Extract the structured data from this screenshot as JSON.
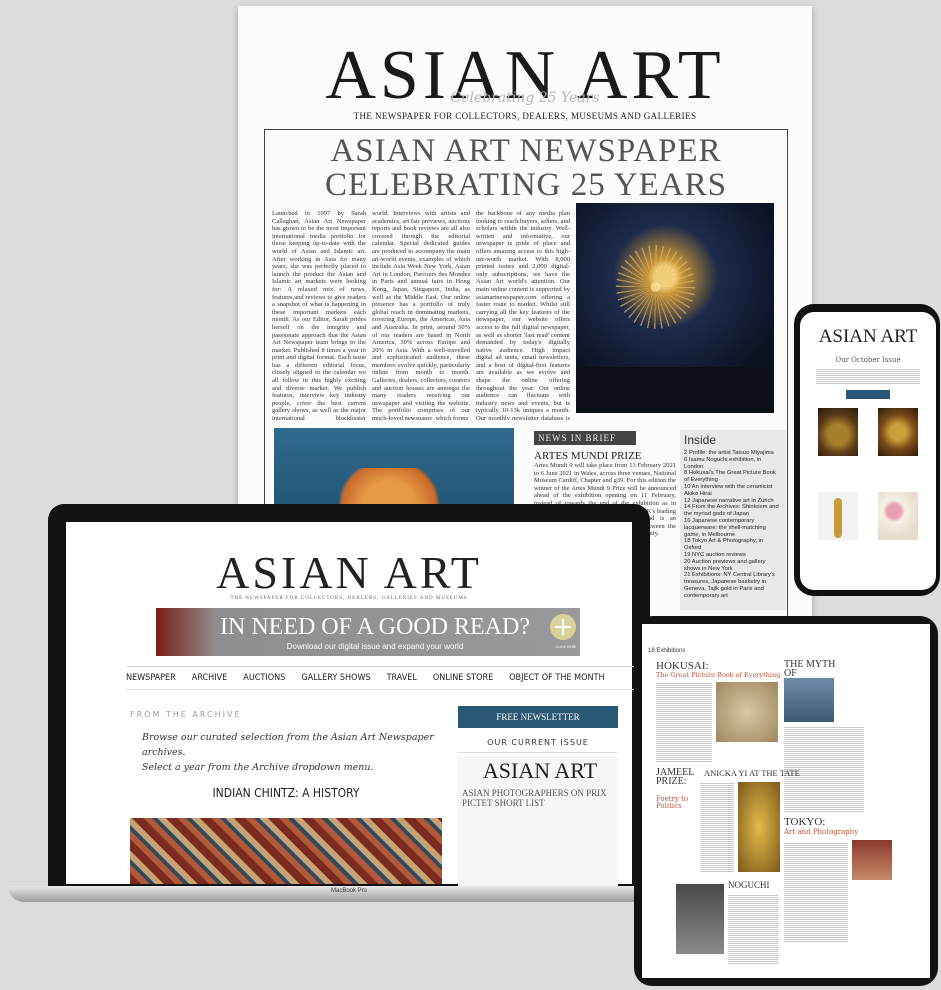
{
  "newspaper": {
    "masthead": "ASIAN ART",
    "anniversary": "Celebrating 25 Years",
    "tagline": "THE NEWSPAPER FOR COLLECTORS, DEALERS, MUSEUMS AND GALLERIES",
    "headline_line1": "ASIAN ART NEWSPAPER",
    "headline_line2": "CELEBRATING 25 YEARS",
    "col1": "Launched in 1997 by Sarah Callaghan, Asian Art Newspaper has grown to be the most important international media portfolio for those keeping up-to-date with the world of Asian and Islamic art. After working in Asia for many years, she was perfectly placed to launch the product the Asian and Islamic art markets were looking for: A relaxed mix of news, features,and reviews to give readers a snapshot of what is happening in these important markets each month. As our Editor, Sarah prides herself on the integrity and passionate approach that the Asian Art Newspaper team brings to the market. Published 8 times a year in print and digital format. Each issue has a different editorial focus, closely aligned to the calendar we all follow in this highly exciting and diverse market. We publish features, interview key industry people, cover the best current gallery shows, as well as the major international blockbuster exhibitions around the",
    "col2": "world. Interviews with artists and academics, art fair previews, auctions reports and book reviews are all also covered through the editorial calendar. Special dedicated guides are produced to accompany the main art-world events, examples of which include Asia Week New York, Asian Art in London, Parcours des Mondes in Paris and annual fairs in Hong Kong, Japan, Singapore, India, as well as the Middle East. Our online presence has a portfolio of truly global reach in dominating markets, covering Europe, the Americas, Asia and Australia. In print, around 50% of our readers are based in North America, 30% across Europe and 20% in Asia. With a well-travelled and sophisticated audience, these members evolve quickly, particularly online from month to month. Galleries, dealers, collectors, curators and auction houses are amongst the many readers receiving our newspaper and visiting the website. The portfolio comprises of our much-loved newspaper, which forms",
    "col3": "the backbone of any media plan looking to reach buyers, sellers, and scholars within the industry. Well-written and informative, our newspaper is pride of place and offers amazing access to this high-net-worth market. With 8,000 printed issues and 2,000 digital-only subscriptions, we have the Asian Art world's attention. Our main online content is supported by asianartnewspaper.com offering a faster route to market. Whilst still carrying all the key features of the newspaper, our website offers access to the full digital newspaper, as well as shorter 'fast read' content demanded by today's digitally native audience. High impact digital ad units, email newsletters, and a host of digital-first features are available as we evolve and shape the online offering throughout the year. Our online audience can fluctuate with industry news and events, but is typically 10-13k uniques a month. Our monthly newsletter database is circa 6k targeted individuals.",
    "news_label": "NEWS IN BRIEF",
    "artes_title": "ARTES MUNDI PRIZE",
    "artes_text": "Artes Mundi 9 will take place from 13 February 2021 to 6 June 2021 in Wales, across three venues, National Museum Cardiff, Chapter and g39. For this edition the winner of the Artes Mundi 9 Prize will be announced ahead of the exhibition opening on 11 February, instead of towards the end of the exhibition as in previous years. Artes Mundi presents the UK's leading international contemporary art prize and is an important arbiter of cultural exchange between the UK and the international visual arts community.",
    "inside_title": "Inside",
    "inside_items": [
      "2 Profile: the artist Tatsuo Miyajima",
      "6 Isamu Noguchi exhibition, in London",
      "8 Hokusai's The Great Picture Book of Everything",
      "10 An interview with the ceramicist Akiko Hirai",
      "12 Japanese narrative art in Zurich",
      "14 From the Archives: Shintoism and the myriad gods of Japan",
      "16 Japanese contemporary lacquerware: the shell-matching game, in Melbourne",
      "18 Tokyo Art & Photography, in Oxford",
      "19 NYC auction reviews",
      "20 Auction previews and gallery shows in New York",
      "21 Exhibitions: NY Central Library's treasures, Japanese basketry in Geneva, Tajik gold in Paris and contemporary art"
    ]
  },
  "phone": {
    "title": "ASIAN ART",
    "subtitle": "Our October Issue"
  },
  "laptop": {
    "masthead": "ASIAN ART",
    "tagline": "THE NEWSPAPER FOR COLLECTORS, DEALERS, GALLERIES AND MUSEUMS",
    "banner_title": "IN NEED OF A GOOD READ?",
    "banner_sub": "Download our digital issue and expand your world",
    "banner_click": "CLICK HERE",
    "nav": [
      "NEWSPAPER",
      "ARCHIVE",
      "AUCTIONS",
      "GALLERY SHOWS",
      "TRAVEL",
      "ONLINE STORE",
      "OBJECT OF THE MONTH"
    ],
    "from_archive": "FROM THE ARCHIVE",
    "browse_line1": "Browse our curated selection from the Asian Art Newspaper archives.",
    "browse_line2": "Select a year from the Archive dropdown menu.",
    "article_title": "INDIAN CHINTZ: A HISTORY",
    "free_newsletter": "FREE NEWSLETTER",
    "current_issue": "OUR CURRENT ISSUE",
    "mini_title": "ASIAN ART",
    "mini_headline": "ASIAN PHOTOGRAPHERS ON PRIX PICTET SHORT LIST",
    "brand": "MacBook Pro"
  },
  "tablet": {
    "page_header": "18 Exhibitions",
    "hokusai_title": "HOKUSAI:",
    "hokusai_sub": "The Great Picture Book of Everything",
    "myth_title": "THE MYTH OF SURVIVAL",
    "jameel_title": "JAMEEL PRIZE:",
    "poetry": "Poetry to Politics",
    "anicka_title": "ANICKA YI AT THE TATE",
    "tokyo_title": "TOKYO:",
    "tokyo_sub": "Art and Photography",
    "noguchi_title": "NOGUCHI"
  }
}
